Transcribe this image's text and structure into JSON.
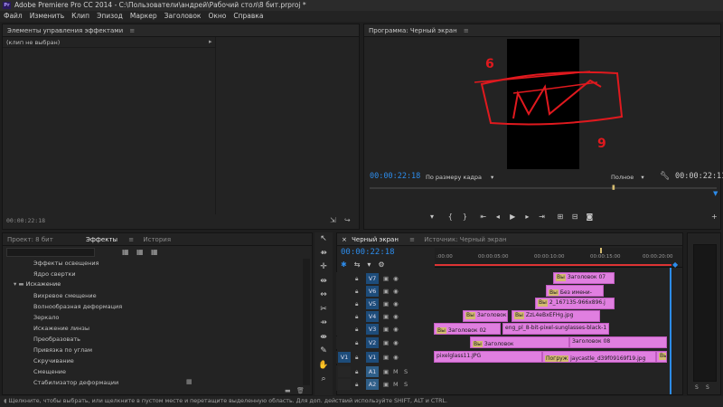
{
  "window": {
    "title": "Adobe Premiere Pro CC 2014 - C:\\Пользователи\\андрей\\Рабочий стол\\8 бит.prproj *",
    "logo": "Pr"
  },
  "menu": [
    "Файл",
    "Изменить",
    "Клип",
    "Эпизод",
    "Маркер",
    "Заголовок",
    "Окно",
    "Справка"
  ],
  "effect_controls": {
    "title": "Элементы управления эффектами",
    "menu_icon": "≡",
    "no_clip": "(клип не выбран)",
    "timecode": "00:00:22:18"
  },
  "program": {
    "title": "Программа: Черный экран",
    "timecode_left": "00:00:22:18",
    "fit_label": "По размеру кадра",
    "quality_label": "Полное",
    "timecode_right": "00:00:22:11",
    "annotation_6": "6",
    "annotation_9": "9"
  },
  "project_tabs": {
    "project": "Проект: 8 бит",
    "effects": "Эффекты",
    "history": "История"
  },
  "effects_list": [
    "Эффекты освещения",
    "Ядро свертки",
    "Искажение",
    "Вихревое смещение",
    "Волнообразная деформация",
    "Зеркало",
    "Искажение линзы",
    "Преобразовать",
    "Привязка по углам",
    "Скручивание",
    "Смещение",
    "Стабилизатор деформации"
  ],
  "timeline": {
    "tab_active": "Черный экран",
    "tab_source": "Источник: Черный экран",
    "timecode": "00:00:22:18",
    "ruler": [
      ":00:00",
      "00:00:05:00",
      "00:00:10:00",
      "00:00:15:00",
      "00:00:20:00"
    ],
    "tracks": [
      "V7",
      "V6",
      "V5",
      "V4",
      "V3",
      "V2",
      "V1",
      "A1",
      "A2"
    ],
    "clips": {
      "v7": "Заголовок 07",
      "v6": "Без имени-",
      "v5": "2_167135-966x896.j",
      "v4a": "Заголовок",
      "v4b": "ZzL4eBxEFHg.jpg",
      "v3a": "Заголовок 02",
      "v3b": "eng_pl_8-bit-pixel-sunglasses-black-1",
      "v2a": "Заголовок",
      "v2b": "Заголовок 08",
      "v1a": "pixelglass11.JPG",
      "v1b": "jaycastle_d39f09169f19.jpg",
      "v1c": "Погруж"
    },
    "audio_meter": [
      "S",
      "S"
    ]
  },
  "status": "Щелкните, чтобы выбрать, или щелкните в пустом месте и перетащите выделенную область. Для доп. действий используйте SHIFT, ALT и CTRL."
}
